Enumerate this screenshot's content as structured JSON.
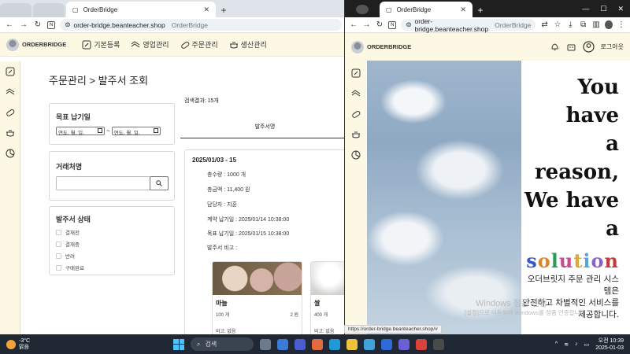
{
  "left": {
    "tab_title": "OrderBridge",
    "url_site": "order-bridge.beanteacher.shop",
    "url_title": "OrderBridge",
    "brand": "ORDERBRIDGE",
    "menu": [
      "기본등록",
      "영업관리",
      "주문관리",
      "생산관리"
    ],
    "page_title": "주문관리 > 발주서 조회",
    "filters": {
      "target_date_label": "목표 납기일",
      "date_placeholder": "연도. 월. 일.",
      "date_separator": "~",
      "client_label": "거래처명",
      "status_label": "발주서 상태",
      "statuses": [
        "결재전",
        "결재중",
        "반려",
        "구매완료"
      ]
    },
    "result_count": "검색결과: 15개",
    "list_tab": "발주서명",
    "order": {
      "title": "2025/01/03 - 15",
      "total_qty": "총수량 : 1000 개",
      "total_amount": "총금액 : 11,400 원",
      "manager": "담당자 : 지훈",
      "contract_date": "계약 납기일 : 2025/01/14 10:38:00",
      "target_date": "목표 납기일 : 2025/01/15 10:38:00",
      "remark": "발주서 비고 :"
    },
    "products": [
      {
        "name": "마늘",
        "qty": "100 개",
        "price": "2 원",
        "note": "비고: 없음"
      },
      {
        "name": "쌀",
        "qty": "400 개",
        "price": "",
        "note": "비고: 없음"
      }
    ]
  },
  "right": {
    "tab_title": "OrderBridge",
    "url_site": "order-bridge.beanteacher.shop",
    "url_title": "OrderBridge",
    "brand": "ORDERBRIDGE",
    "logout": "로그아웃",
    "hero_lines": [
      "You have",
      "a",
      "reason,",
      "We have a"
    ],
    "solution_letters": [
      "s",
      "o",
      "l",
      "u",
      "t",
      "i",
      "o",
      "n"
    ],
    "solution_colors": [
      "#3a55c7",
      "#d8872c",
      "#2b9a5a",
      "#c64a8f",
      "#d8a93a",
      "#5aa3d8",
      "#8c5fc9",
      "#c23b3b"
    ],
    "desc_lines": [
      "오더브릿지 주문 관리 시스",
      "템은",
      "안전하고 차별적인 서비스를",
      "제공합니다."
    ],
    "status_url": "https://order-bridge.beanteacher.shop/#"
  },
  "watermark": [
    "Windows 정품 인증",
    "[설정]으로 이동하여 Windows를 정품 인증합니다."
  ],
  "taskbar": {
    "temp": "-3°C",
    "weather": "맑음",
    "search": "검색",
    "time": "오전 10:39",
    "date": "2025-01-03"
  },
  "colors": {
    "header_bg": "#fcf8e3",
    "taskbar_bg": "#202833"
  }
}
